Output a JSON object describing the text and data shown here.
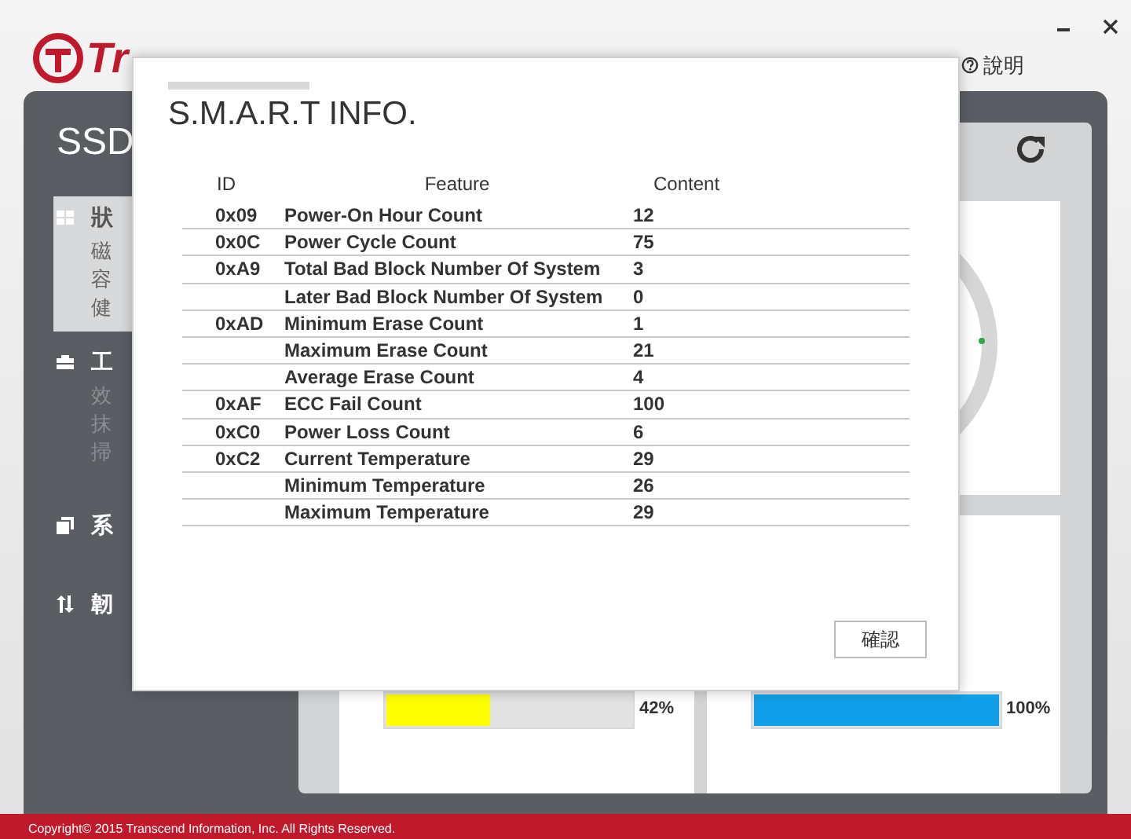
{
  "app": {
    "logo_text": "Tr",
    "help_label": "說明",
    "panel_title": "SSD",
    "copyright": "Copyright© 2015 Transcend Information, Inc. All Rights Reserved."
  },
  "sidebar": [
    {
      "label": "狀",
      "selected": true,
      "items": [
        "磁",
        "容",
        "健"
      ]
    },
    {
      "label": "工",
      "selected": false,
      "items": [
        "效",
        "抹",
        "掃"
      ]
    },
    {
      "label": "系",
      "selected": false
    },
    {
      "label": "韌",
      "selected": false
    }
  ],
  "meters": [
    {
      "level": 0.42,
      "reading": "42%",
      "color": "#ffff00"
    },
    {
      "level": 1,
      "reading": "100%",
      "color": "#109fe8"
    }
  ],
  "dialog": {
    "title": "S.M.A.R.T INFO.",
    "columns": [
      "ID",
      "Feature",
      "Content"
    ],
    "rows": [
      [
        "0x09",
        "Power-On Hour Count",
        "12"
      ],
      [
        "0x0C",
        "Power Cycle Count",
        "75"
      ],
      [
        "0xA9",
        "Total Bad Block Number Of System",
        "3"
      ],
      [
        "",
        "Later Bad Block Number Of System",
        "0"
      ],
      [
        "0xAD",
        "Minimum Erase Count",
        "1"
      ],
      [
        "",
        "Maximum Erase Count",
        "21"
      ],
      [
        "",
        "Average Erase Count",
        "4"
      ],
      [
        "0xAF",
        "ECC Fail Count",
        "100"
      ],
      [
        "0xC0",
        "Power Loss Count",
        "6"
      ],
      [
        "0xC2",
        "Current Temperature",
        "29"
      ],
      [
        "",
        "Minimum Temperature",
        "26"
      ],
      [
        "",
        "Maximum Temperature",
        "29"
      ]
    ],
    "button": "確認"
  }
}
